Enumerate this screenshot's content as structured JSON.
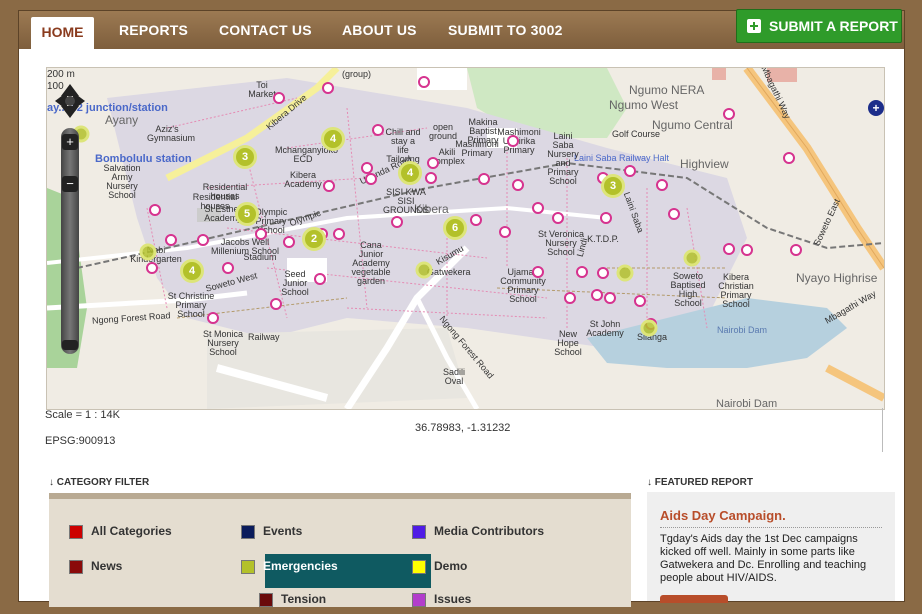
{
  "nav": {
    "home": "HOME",
    "reports": "REPORTS",
    "contact": "CONTACT US",
    "about": "ABOUT US",
    "submit_to": "SUBMIT TO 3002",
    "submit_report": "SUBMIT A REPORT"
  },
  "map": {
    "scale_top": "200 m",
    "scale_bottom": "100",
    "labels_blue": [
      "ay... 42 junction/station",
      "Bombolulu station",
      "Laini Saba Railway Halt"
    ],
    "places": {
      "ngumo_nera": "Ngumo NERA",
      "ngumo_west": "Ngumo West",
      "ngumo_central": "Ngumo Central",
      "highview": "Highview",
      "ayany": "Ayany",
      "kibera": "Kibera",
      "nyayo": "Nyayo Highrise",
      "nairobi_dam": "Nairobi Dam",
      "nairobi_dam_small": "Nairobi Dam",
      "mbagathi_way": "Mbagathi Way",
      "mbagathi_way2": "Mbagathi Way",
      "soweto_east": "Soweto East",
      "golf_course": "Golf Course",
      "ngong_forest": "Ngong Forest Road",
      "kibera_drive": "Kibera Drive",
      "olympic": "Olympic",
      "uganda_road": "Uganda Road",
      "kisumu": "Kisumu",
      "soweto_west": "Soweto West",
      "railway": "Railway",
      "toi_market": "Toi Market",
      "group": "(group)",
      "open_ground": "open ground",
      "makina": "Makina Baptist Primary",
      "mashimoni": "Mashimoni Primary",
      "mashimoni_ushirika": "Mashimoni Ushirika Primary",
      "laini_saba": "Laini Saba Nursery and Primary School",
      "chill": "Chill and stay a life Tailoring",
      "akili": "Akili Complex",
      "sisi": "SISI KWA SISI GROUNDS",
      "mchanga": "Mchanganyioko ECD",
      "kibera_academy": "Kibera Academy",
      "salvation": "Salvation Army Nursery School",
      "azizs": "Aziz's Gymnasium",
      "residential1": "Residential houses",
      "residential2": "Residential houses",
      "st_esther": "St Esther Academy",
      "olympic_school": "Olympic Primary School",
      "jacobs": "Jacobs Well Millenium School",
      "stadium": "Stadium",
      "nabi": "Nabi Kindergarten",
      "st_christine": "St Christine Primary School",
      "seed": "Seed Junior School",
      "cana": "Cana Junior Academy vegetable garden",
      "gatwekera": "Gatwekera",
      "ujamaa": "Ujamaa Community Primary School",
      "st_veronica": "St Veronica Nursery School",
      "ktdp": "K.T.D.P.",
      "soweto_baptised": "Soweto Baptised High School",
      "kibera_christian": "Kibera Christian Primary School",
      "st_monica": "St Monica Nursery School",
      "new_hope": "New Hope School",
      "st_john": "St John Academy",
      "silanga": "Silanga",
      "sadili": "Sadili Oval",
      "ngong_forest_road2": "Ngong Forest Road",
      "lindi": "Lindi",
      "laini_saba_road": "Laini Saba"
    },
    "clusters": [
      "3",
      "4",
      "4",
      "3",
      "5",
      "2",
      "6",
      "4",
      "4"
    ],
    "scale_text": "Scale = 1 : 14K",
    "epsg": "EPSG:900913",
    "coords": "36.78983, -1.31232"
  },
  "category_filter": {
    "heading": "↓ CATEGORY FILTER",
    "items": [
      {
        "label": "All Categories",
        "color": "#cc0000"
      },
      {
        "label": "Events",
        "color": "#0b1c5c"
      },
      {
        "label": "Media Contributors",
        "color": "#4f1ce6"
      },
      {
        "label": "News",
        "color": "#8a0a0a"
      },
      {
        "label": "Emergencies",
        "color": "#b3c12a"
      },
      {
        "label": "Demo",
        "color": "#ffff00"
      },
      {
        "label": "Tension",
        "color": "#6a0a0a"
      },
      {
        "label": "Issues",
        "color": "#b33dcc"
      }
    ]
  },
  "featured": {
    "heading": "↓ FEATURED REPORT",
    "title": "Aids Day Campaign.",
    "body": "Tgday's Aids day the 1st Dec campaigns kicked off well. Mainly in some parts like Gatwekera and Dc. Enrolling and teaching people about HIV/AIDS."
  },
  "colors": {
    "nav_bg": "#8b6a45",
    "submit_green": "#2f9b2a",
    "active_category": "#0f5a61",
    "featured_title": "#b84d2a",
    "marker_pink": "#d6338f",
    "cluster_green": "#b3c12a"
  }
}
